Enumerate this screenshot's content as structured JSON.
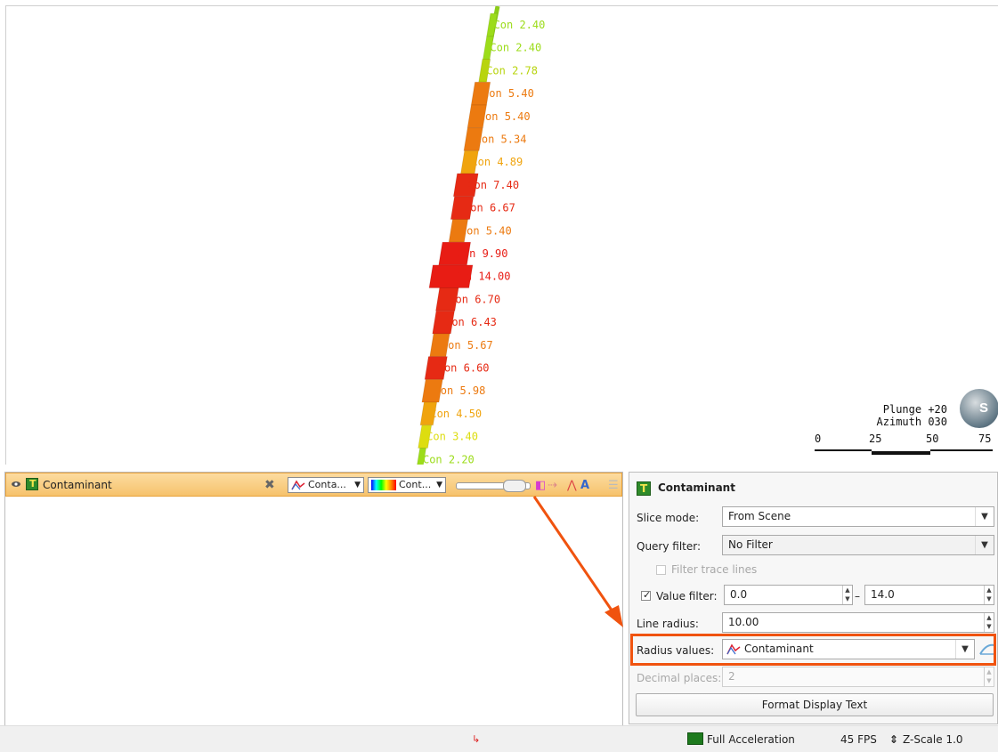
{
  "scene": {
    "labels": [
      {
        "text": "Con 2.40",
        "color": "#9cdc1a"
      },
      {
        "text": "Con 2.40",
        "color": "#9cdc1a"
      },
      {
        "text": "Con 2.78",
        "color": "#b8d40e"
      },
      {
        "text": "Con 5.40",
        "color": "#ec7a10"
      },
      {
        "text": "Con 5.40",
        "color": "#ec7a10"
      },
      {
        "text": "Con 5.34",
        "color": "#ec7a10"
      },
      {
        "text": "Con 4.89",
        "color": "#f0a40e"
      },
      {
        "text": "Con 7.40",
        "color": "#e62a14"
      },
      {
        "text": "Con 6.67",
        "color": "#e62a14"
      },
      {
        "text": "Con 5.40",
        "color": "#ec7a10"
      },
      {
        "text": "Con 9.90",
        "color": "#e81c14"
      },
      {
        "text": "Con 14.00",
        "color": "#e81c14"
      },
      {
        "text": "Con 6.70",
        "color": "#e62a14"
      },
      {
        "text": "Con 6.43",
        "color": "#e62a14"
      },
      {
        "text": "Con 5.67",
        "color": "#ec7a10"
      },
      {
        "text": "Con 6.60",
        "color": "#e62a14"
      },
      {
        "text": "Con 5.98",
        "color": "#ec7a10"
      },
      {
        "text": "Con 4.50",
        "color": "#f0a40e"
      },
      {
        "text": "Con 3.40",
        "color": "#dddd10"
      },
      {
        "text": "Con 2.20",
        "color": "#9cdc1a"
      }
    ],
    "orientation": {
      "plunge": "Plunge +20",
      "azimuth": "Azimuth 030"
    },
    "globe_letter": "S",
    "scale_ticks": [
      "0",
      "25",
      "50",
      "75"
    ]
  },
  "list_panel": {
    "object_name": "Contaminant",
    "combo1": "Conta...",
    "combo2": "Cont..."
  },
  "properties": {
    "title": "Contaminant",
    "slice_mode_label": "Slice mode:",
    "slice_mode_value": "From Scene",
    "query_filter_label": "Query filter:",
    "query_filter_value": "No Filter",
    "filter_trace_lines": "Filter trace lines",
    "value_filter_label": "Value filter:",
    "value_filter_min": "0.0",
    "value_filter_max": "14.0",
    "value_filter_sep": "–",
    "line_radius_label": "Line radius:",
    "line_radius_value": "10.00",
    "radius_values_label": "Radius values:",
    "radius_values_value": "Contaminant",
    "decimal_places_label": "Decimal places:",
    "decimal_places_value": "2",
    "format_button": "Format Display Text"
  },
  "status": {
    "acceleration": "Full Acceleration",
    "fps": "45 FPS",
    "zscale": "Z-Scale 1.0"
  },
  "colors": {
    "highlight": "#f0530f",
    "header": "#f6c26c"
  }
}
